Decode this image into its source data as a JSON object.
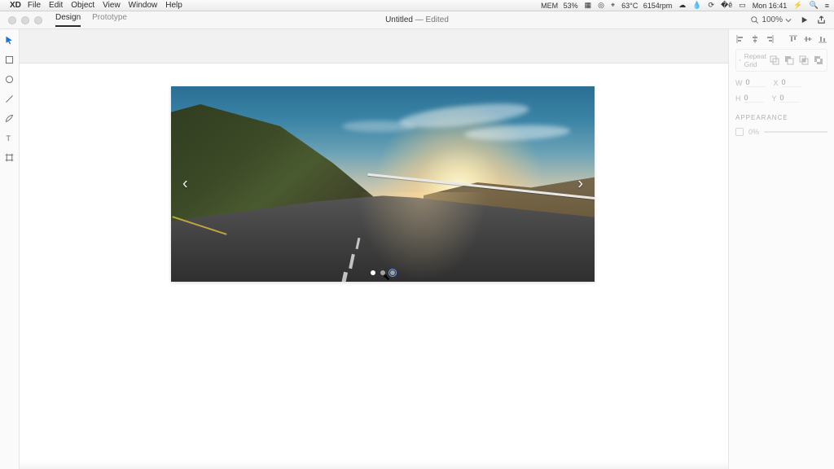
{
  "menubar": {
    "app": "XD",
    "items": [
      "File",
      "Edit",
      "Object",
      "View",
      "Window",
      "Help"
    ],
    "mem_label": "MEM",
    "mem_pct": "53%",
    "temp": "63°C",
    "ram": "6154rpm",
    "clock": "Mon 16:41"
  },
  "titlebar": {
    "tabs": {
      "design": "Design",
      "prototype": "Prototype"
    },
    "document": "Untitled",
    "suffix": " — Edited",
    "zoom": "100%"
  },
  "right_panel": {
    "repeat_grid": "Repeat Grid",
    "w_label": "W",
    "w_value": "0",
    "x_label": "X",
    "x_value": "0",
    "h_label": "H",
    "h_value": "0",
    "y_label": "Y",
    "y_value": "0",
    "section": "APPEARANCE",
    "opacity": "0%"
  },
  "carousel": {
    "slides": 3,
    "active_index": 0
  },
  "icons": {
    "search": "search-icon",
    "chevron_down": "chevron-down-icon",
    "play": "play-icon",
    "share": "share-icon",
    "select": "select-tool-icon",
    "rect": "rectangle-tool-icon",
    "ellipse": "ellipse-tool-icon",
    "line": "line-tool-icon",
    "pen": "pen-tool-icon",
    "text": "text-tool-icon",
    "artboard": "artboard-tool-icon",
    "grid": "grid-icon"
  }
}
